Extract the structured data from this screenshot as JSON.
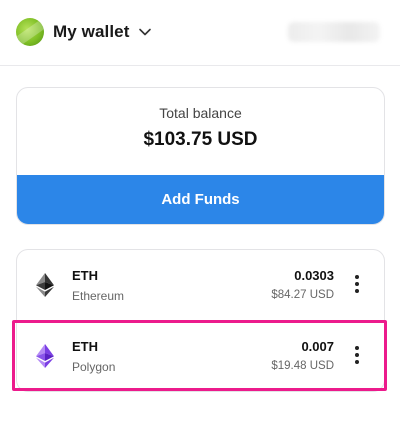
{
  "header": {
    "wallet_name": "My wallet",
    "avatar_icon": "wallet-avatar",
    "chevron_icon": "chevron-down-icon"
  },
  "balance": {
    "label": "Total balance",
    "value": "$103.75 USD",
    "add_funds_label": "Add Funds",
    "button_color": "#2c86e8"
  },
  "assets": [
    {
      "symbol": "ETH",
      "network": "Ethereum",
      "amount": "0.0303",
      "usd": "$84.27 USD",
      "icon": "ethereum-icon",
      "icon_color": "#333333"
    },
    {
      "symbol": "ETH",
      "network": "Polygon",
      "amount": "0.007",
      "usd": "$19.48 USD",
      "icon": "ethereum-polygon-icon",
      "icon_color": "#7b3fe4"
    }
  ],
  "highlight": {
    "color": "#ec1b8c",
    "target": "assets.1"
  }
}
